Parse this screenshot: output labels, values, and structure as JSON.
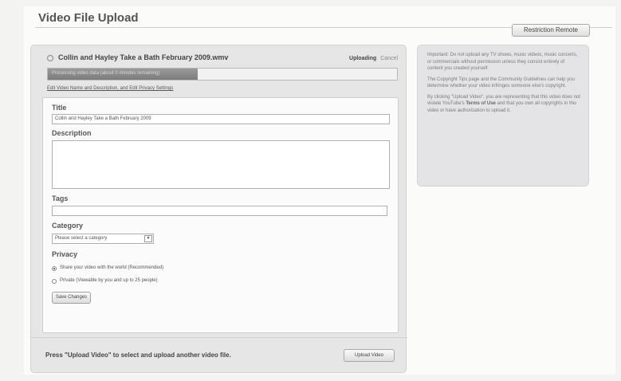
{
  "page": {
    "title": "Video File Upload",
    "restriction_button": "Restriction Remote"
  },
  "upload": {
    "file_name": "Collin and Hayley Take a Bath February 2009.wmv",
    "status_label": "Uploading",
    "cancel_label": "Cancel",
    "progress_percent": 43,
    "progress_text": "Processing video data (about 0 minutes remaining)",
    "edit_link": "Edit Video Name and Description, and Edit Privacy Settings"
  },
  "form": {
    "title_label": "Title",
    "title_value": "Collin and Hayley Take a Bath February 2009",
    "description_label": "Description",
    "description_value": "",
    "tags_label": "Tags",
    "tags_value": "",
    "category_label": "Category",
    "category_selected": "Please select a category",
    "privacy_label": "Privacy",
    "privacy_options": [
      {
        "label": "Share your video with the world (Recommended)",
        "checked": true
      },
      {
        "label": "Private (Viewable by you and up to 25 people)",
        "checked": false
      }
    ],
    "save_button": "Save Changes"
  },
  "footer": {
    "text": "Press \"Upload Video\" to select and upload another video file.",
    "upload_button": "Upload Video"
  },
  "info": {
    "p1": "Important: Do not upload any TV shows, music videos, music concerts, or commercials without permission unless they consist entirely of content you created yourself.",
    "p2_before": "The",
    "p2_link1": "Copyright Tips page",
    "p2_middle": "and the",
    "p2_link2": "Community Guidelines",
    "p2_after": "can help you determine whether your video infringes someone else's copyright.",
    "p3_before": "By clicking \"Upload Video\", you are representing that this video does not violate YouTube's",
    "p3_link": "Terms of Use",
    "p3_after": "and that you own all copyrights in this video or have authorization to upload it."
  }
}
